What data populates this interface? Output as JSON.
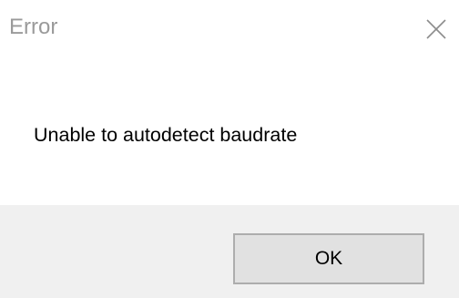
{
  "window": {
    "title": "Error",
    "close_icon": "close-icon"
  },
  "message": {
    "text": "Unable to autodetect baudrate"
  },
  "buttons": {
    "ok_label": "OK"
  }
}
